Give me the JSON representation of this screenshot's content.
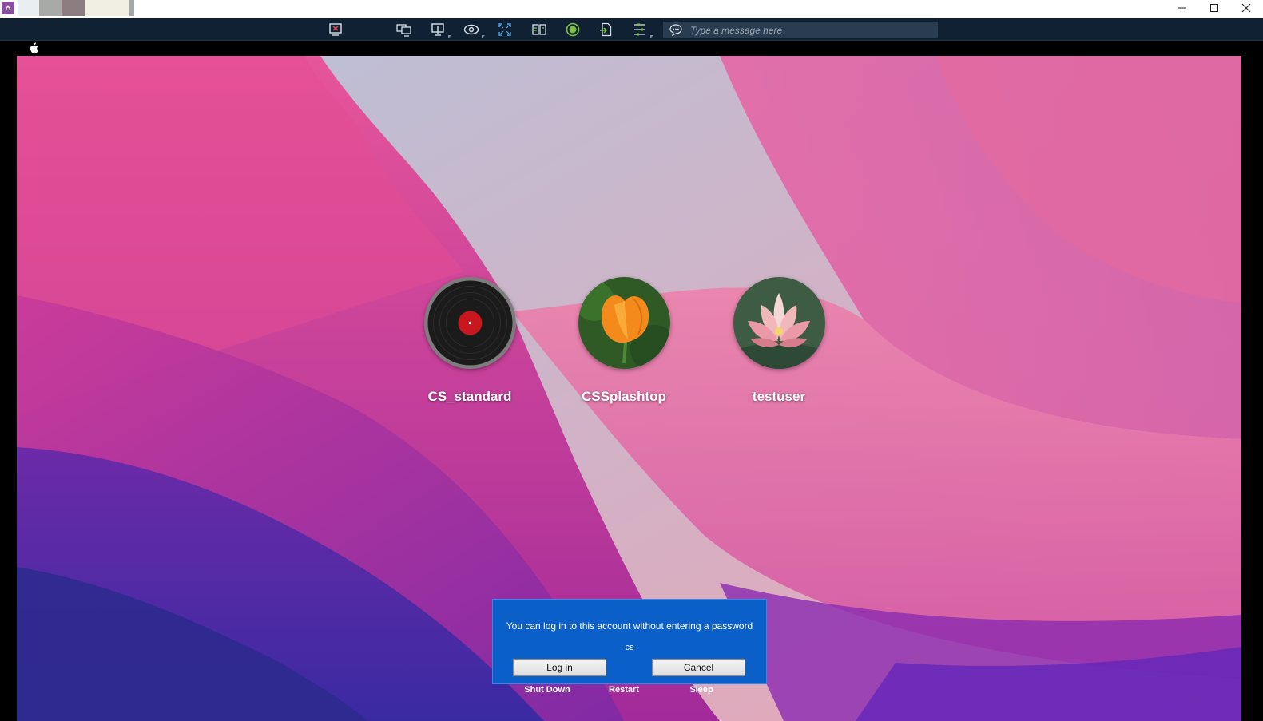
{
  "window": {
    "swatch_colors": [
      "#e9eef0",
      "#a7aaa6",
      "#8d7d80",
      "#f1eee3",
      "#a4a8a6"
    ],
    "controls": [
      "minimize-icon",
      "maximize-icon",
      "close-icon"
    ]
  },
  "toolbar": {
    "buttons": [
      "disconnect-icon",
      "switch-monitor-icon",
      "display-icon",
      "view-only-icon",
      "fullscreen-icon",
      "file-transfer-icon",
      "record-icon",
      "file-icon",
      "more-options-icon"
    ],
    "message_placeholder": "Type a message here"
  },
  "menubar": {
    "icon": "apple-icon"
  },
  "login": {
    "users": [
      {
        "name": "CS_standard",
        "avatar": "vinyl-record"
      },
      {
        "name": "CSSplashtop",
        "avatar": "orange-poppy"
      },
      {
        "name": "testuser",
        "avatar": "pink-lotus"
      }
    ],
    "dialog": {
      "message": "You can log in to this account without entering a password",
      "user": "cs",
      "login_label": "Log in",
      "cancel_label": "Cancel"
    },
    "power": {
      "shutdown": "Shut Down",
      "restart": "Restart",
      "sleep": "Sleep"
    }
  }
}
